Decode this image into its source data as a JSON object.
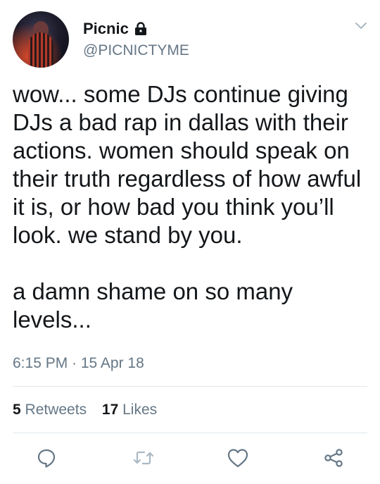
{
  "user": {
    "name": "Picnic",
    "handle": "@PICNICTYME"
  },
  "tweet": {
    "text": "wow... some DJs continue giving DJs a bad rap in dallas with their actions. women should speak on their truth regardless of how awful it is, or how bad you think you’ll look. we stand by you.\n\na damn shame on so many levels...",
    "timestamp": "6:15 PM · 15 Apr 18"
  },
  "stats": {
    "retweets_count": "5",
    "retweets_label": "Retweets",
    "likes_count": "17",
    "likes_label": "Likes"
  },
  "icons": {
    "lock": "lock-icon",
    "chevron": "chevron-down-icon",
    "reply": "reply-icon",
    "retweet": "retweet-icon",
    "like": "heart-icon",
    "share": "share-icon"
  },
  "colors": {
    "primary_text": "#14171a",
    "secondary_text": "#657786",
    "icon": "#657786",
    "divider": "#e1e8ed"
  }
}
